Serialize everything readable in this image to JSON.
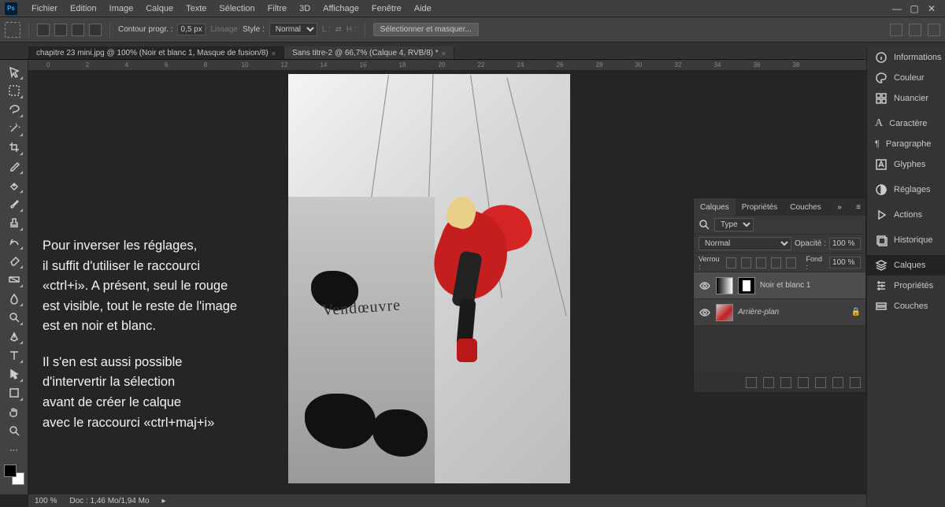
{
  "menu": {
    "items": [
      "Fichier",
      "Edition",
      "Image",
      "Calque",
      "Texte",
      "Sélection",
      "Filtre",
      "3D",
      "Affichage",
      "Fenêtre",
      "Aide"
    ],
    "logo": "Ps"
  },
  "optbar": {
    "contour_label": "Contour progr. :",
    "contour_value": "0,5 px",
    "lissage": "Lissage",
    "style_label": "Style :",
    "style_value": "Normal",
    "l_label": "L :",
    "h_label": "H :",
    "select_mask": "Sélectionner et masquer..."
  },
  "tabs": [
    {
      "label": "chapitre 23 mini.jpg @ 100% (Noir et blanc 1, Masque de fusion/8)",
      "active": true
    },
    {
      "label": "Sans titre-2 @ 66,7% (Calque 4, RVB/8) *",
      "active": false
    }
  ],
  "ruler": [
    "0",
    "2",
    "4",
    "6",
    "8",
    "10",
    "12",
    "14",
    "16",
    "18",
    "20",
    "22",
    "24",
    "26",
    "28",
    "30",
    "32",
    "34",
    "36",
    "38"
  ],
  "overlay": {
    "p1": "Pour inverser les réglages,\nil suffit d'utiliser le raccourci\n«ctrl+i». A présent, seul le rouge\nest visible, tout le reste de l'image\nest en noir et blanc.",
    "p2": "Il s'en est aussi possible\nd'intervertir la sélection\navant de créer le calque\navec le raccourci «ctrl+maj+i»"
  },
  "doc": {
    "sign": "Vendœuvre"
  },
  "rail": [
    {
      "icon": "info",
      "label": "Informations"
    },
    {
      "icon": "palette",
      "label": "Couleur"
    },
    {
      "icon": "swatch",
      "label": "Nuancier"
    },
    {
      "sep": true
    },
    {
      "icon": "char",
      "label": "Caractère"
    },
    {
      "icon": "para",
      "label": "Paragraphe"
    },
    {
      "icon": "glyph",
      "label": "Glyphes"
    },
    {
      "sep": true
    },
    {
      "icon": "adjust",
      "label": "Réglages"
    },
    {
      "sep": true
    },
    {
      "icon": "play",
      "label": "Actions"
    },
    {
      "sep": true
    },
    {
      "icon": "history",
      "label": "Historique"
    },
    {
      "sep": true
    },
    {
      "icon": "layers",
      "label": "Calques",
      "active": true
    },
    {
      "icon": "props",
      "label": "Propriétés"
    },
    {
      "icon": "channels",
      "label": "Couches"
    }
  ],
  "panel": {
    "tabs": [
      "Calques",
      "Propriétés",
      "Couches"
    ],
    "active": 0,
    "filter_label": "Type",
    "blend": "Normal",
    "opacity_label": "Opacité :",
    "opacity": "100 %",
    "lock_label": "Verrou :",
    "fill_label": "Fond :",
    "fill": "100 %",
    "layers": [
      {
        "name": "Noir et blanc 1",
        "sel": true,
        "mask": true
      },
      {
        "name": "Arrière-plan",
        "locked": true
      }
    ]
  },
  "status": {
    "zoom": "100 %",
    "doc": "Doc : 1,46 Mo/1,94 Mo"
  },
  "tools": [
    "move",
    "marquee",
    "lasso",
    "wand",
    "crop",
    "eyedrop",
    "heal",
    "brush",
    "stamp",
    "history",
    "eraser",
    "gradient",
    "blur",
    "dodge",
    "pen",
    "type",
    "path",
    "rect",
    "hand",
    "zoom"
  ]
}
